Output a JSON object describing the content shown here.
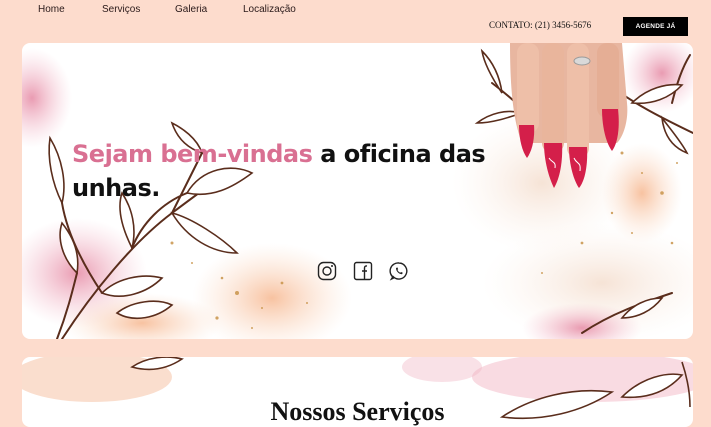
{
  "nav": {
    "items": [
      {
        "label": "Home"
      },
      {
        "label": "Serviços"
      },
      {
        "label": "Galeria"
      },
      {
        "label": "Localização"
      }
    ]
  },
  "contact": {
    "text": "CONTATO: (21) 3456-5676"
  },
  "cta": {
    "label": "AGENDE JÁ"
  },
  "hero": {
    "headline_accent": "Sejam bem-vindas",
    "headline_rest": " a oficina das unhas.",
    "socials": [
      "instagram-icon",
      "facebook-icon",
      "whatsapp-icon"
    ]
  },
  "services": {
    "title": "Nossos Serviços"
  },
  "colors": {
    "background": "#fddccd",
    "accent": "#d97092",
    "nail": "#d41f4a",
    "branch": "#5a2d1c"
  }
}
